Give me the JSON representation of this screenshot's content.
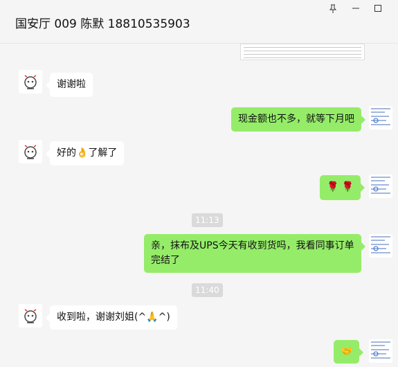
{
  "window": {
    "title": "国安厅 009  陈默 18810535903",
    "pin_icon": "pin-icon",
    "minimize_icon": "minimize-icon",
    "maximize_icon": "maximize-icon"
  },
  "messages": [
    {
      "id": "m1",
      "side": "in",
      "text": "谢谢啦"
    },
    {
      "id": "m2",
      "side": "out",
      "text": "现金额也不多，就等下月吧"
    },
    {
      "id": "m3",
      "side": "in",
      "text": "好的👌了解了"
    },
    {
      "id": "m4",
      "side": "out",
      "text": "🌹 🌹"
    },
    {
      "id": "t1",
      "type": "time",
      "text": "11:13"
    },
    {
      "id": "m5",
      "side": "out",
      "text": "亲，抹布及UPS今天有收到货吗，我看同事订单完结了"
    },
    {
      "id": "t2",
      "type": "time",
      "text": "11:40"
    },
    {
      "id": "m6",
      "side": "in",
      "text": "收到啦，谢谢刘姐(^🙏^)"
    },
    {
      "id": "m7",
      "side": "out",
      "text": "🤝"
    }
  ],
  "colors": {
    "out_bubble": "#95ec69",
    "in_bubble": "#ffffff",
    "background": "#f5f5f5"
  }
}
